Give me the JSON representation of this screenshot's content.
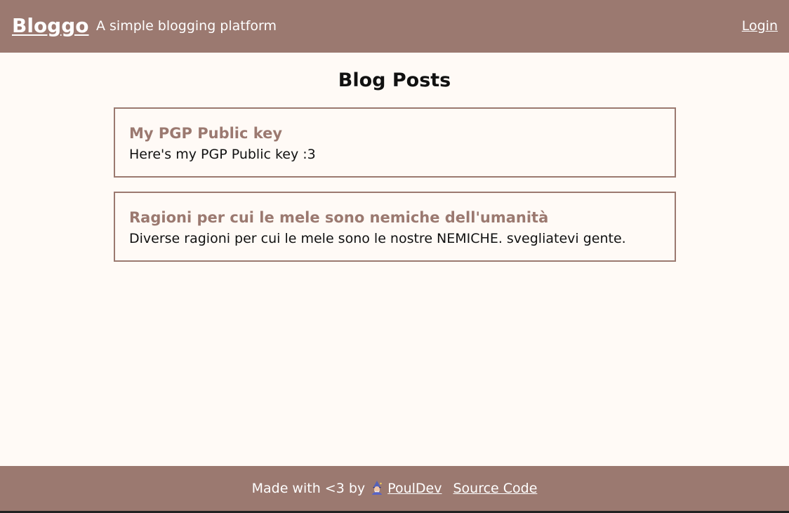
{
  "header": {
    "brand": "Bloggo",
    "tagline": "A simple blogging platform",
    "login_label": "Login"
  },
  "main": {
    "title": "Blog Posts",
    "posts": [
      {
        "title": "My PGP Public key",
        "description": "Here's my PGP Public key :3"
      },
      {
        "title": "Ragioni per cui le mele sono nemiche dell'umanità",
        "description": "Diverse ragioni per cui le mele sono le nostre NEMICHE. svegliatevi gente."
      }
    ]
  },
  "footer": {
    "made_with": "Made with <3 by",
    "author_icon": "wizard-icon",
    "author_link": "PoulDev",
    "source_link": "Source Code"
  },
  "colors": {
    "accent": "#9b7970",
    "background": "#fffaf6",
    "text": "#111111"
  }
}
